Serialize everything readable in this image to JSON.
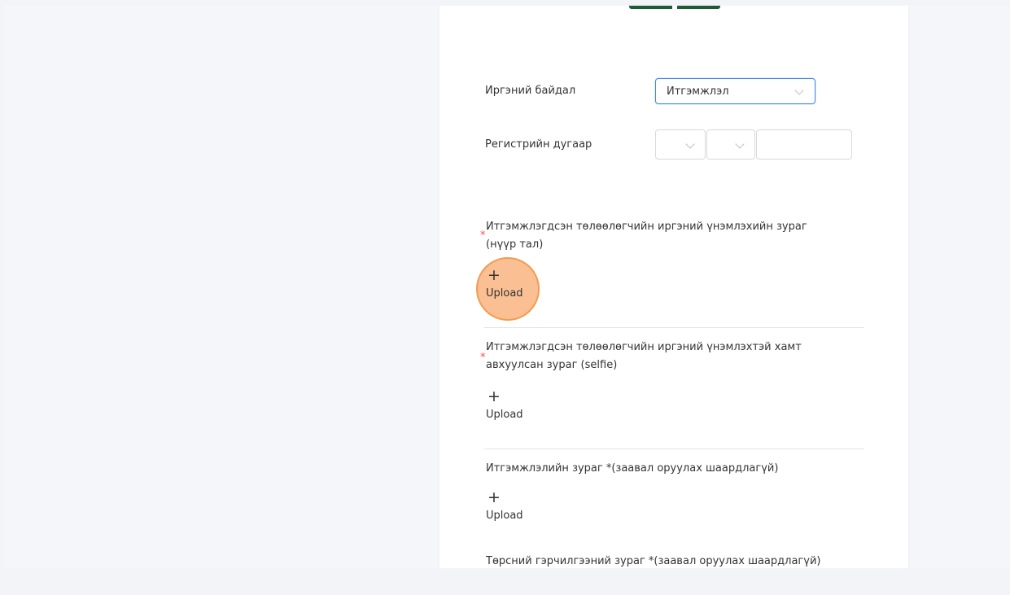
{
  "form": {
    "citizen_status_label": "Иргэний байдал",
    "citizen_status_value": "Итгэмжлэл",
    "register_label": "Регистрийн дугаар",
    "register_input_value": ""
  },
  "sections": [
    {
      "required": true,
      "title_line1": "Итгэмжлэгдсэн төлөөлөгчийн иргэний үнэмлэхийн зураг",
      "title_line2": "(нүүр тал)",
      "upload_label": "Upload"
    },
    {
      "required": true,
      "title_line1": "Итгэмжлэгдсэн төлөөлөгчийн иргэний үнэмлэхтэй хамт",
      "title_line2": "авхуулсан зураг (selfie)",
      "upload_label": "Upload"
    },
    {
      "required": false,
      "title_line1": "Итгэмжлэлийн зураг *(заавал оруулах шаардлагүй)",
      "upload_label": "Upload"
    },
    {
      "required": false,
      "title_line1": "Төрсний гэрчилгээний зураг *(заавал оруулах шаардлагүй)"
    }
  ],
  "symbols": {
    "required_mark": "*",
    "plus": "+"
  },
  "colors": {
    "accent": "#3b8be6",
    "required": "#ff4d4f",
    "brand_green": "#1e5b34",
    "click_highlight": "#f59a4e"
  }
}
